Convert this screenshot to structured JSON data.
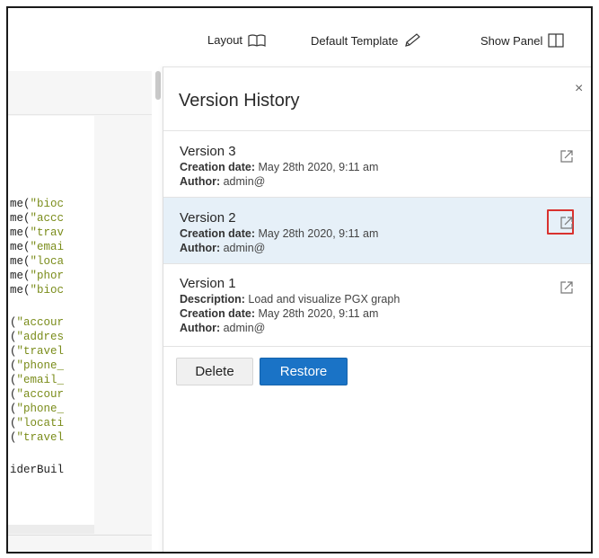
{
  "toolbar": {
    "layout_label": "Layout",
    "template_label": "Default Template",
    "show_panel_label": "Show Panel"
  },
  "code": {
    "lines_a": [
      "me(\"bioc",
      "me(\"accc",
      "me(\"trav",
      "me(\"emai",
      "me(\"loca",
      "me(\"phor",
      "me(\"bioc"
    ],
    "lines_b": [
      "(\"accour",
      "(\"addres",
      "(\"travel",
      "(\"phone_",
      "(\"email_",
      "(\"accour",
      "(\"phone_",
      "(\"locati",
      "(\"travel"
    ],
    "line_c": "iderBuil"
  },
  "panel": {
    "title": "Version History",
    "close_glyph": "×",
    "versions": [
      {
        "title": "Version 3",
        "creation_label": "Creation date:",
        "creation_value": " May 28th 2020, 9:11 am",
        "author_label": "Author:",
        "author_value": " admin@"
      },
      {
        "title": "Version 2",
        "creation_label": "Creation date:",
        "creation_value": " May 28th 2020, 9:11 am",
        "author_label": "Author:",
        "author_value": " admin@"
      },
      {
        "title": "Version 1",
        "description_label": "Description:",
        "description_value": " Load and visualize PGX graph",
        "creation_label": "Creation date:",
        "creation_value": " May 28th 2020, 9:11 am",
        "author_label": "Author:",
        "author_value": " admin@"
      }
    ],
    "delete_label": "Delete",
    "restore_label": "Restore"
  },
  "colors": {
    "accent": "#1a73c6",
    "selected_row": "#e6f0f8",
    "highlight_box": "#d9322f"
  },
  "icons": [
    "book-icon",
    "pen-icon",
    "panel-icon",
    "close-icon",
    "open-external-icon"
  ]
}
